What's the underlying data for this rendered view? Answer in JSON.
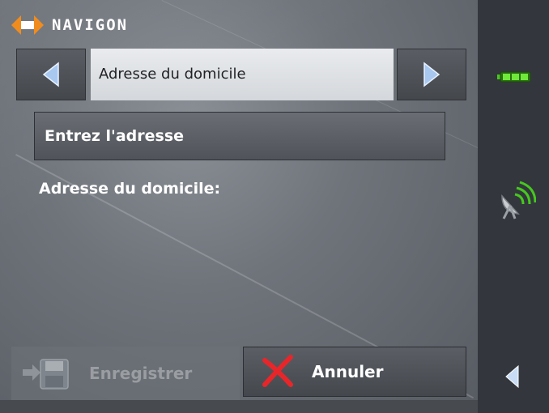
{
  "app": {
    "brand": "NAVIGON"
  },
  "selector": {
    "current_value": "Adresse du domicile"
  },
  "enter_address": {
    "label": "Entrez l'adresse"
  },
  "home_address": {
    "label": "Adresse du domicile:"
  },
  "footer": {
    "save_label": "Enregistrer",
    "save_enabled": false,
    "cancel_label": "Annuler"
  },
  "status": {
    "battery_icon": "battery-icon",
    "gps_icon": "gps-satellite-icon"
  },
  "colors": {
    "accent_orange": "#f08c1e",
    "cancel_red": "#e8262a",
    "battery_green": "#46c81e"
  }
}
